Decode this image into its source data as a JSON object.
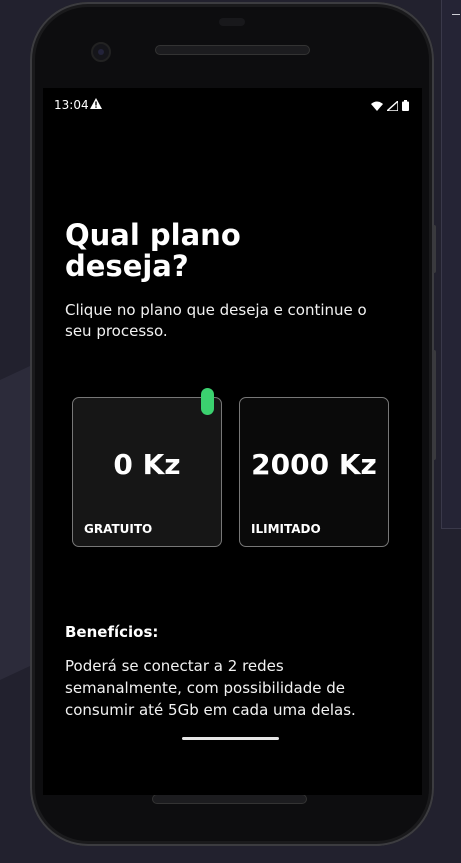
{
  "status_bar": {
    "time": "13:04",
    "alert_icon": "warning-triangle-icon",
    "wifi_icon": "wifi-icon",
    "signal_icon": "signal-icon",
    "battery_icon": "battery-icon"
  },
  "page": {
    "title": "Qual plano\ndeseja?",
    "subtitle": "Clique no plano que deseja e continue o seu processo."
  },
  "plans": [
    {
      "price": "0 Kz",
      "name": "GRATUITO",
      "selected": true
    },
    {
      "price": "2000 Kz",
      "name": "ILIMITADO",
      "selected": false
    }
  ],
  "benefits": {
    "heading": "Benefícios:",
    "text": "Poderá se conectar a 2 redes semanalmente, com possibilidade de consumir até 5Gb em cada uma delas."
  },
  "colors": {
    "accent": "#3bd16f",
    "background": "#000000",
    "card_border": "#777777"
  }
}
